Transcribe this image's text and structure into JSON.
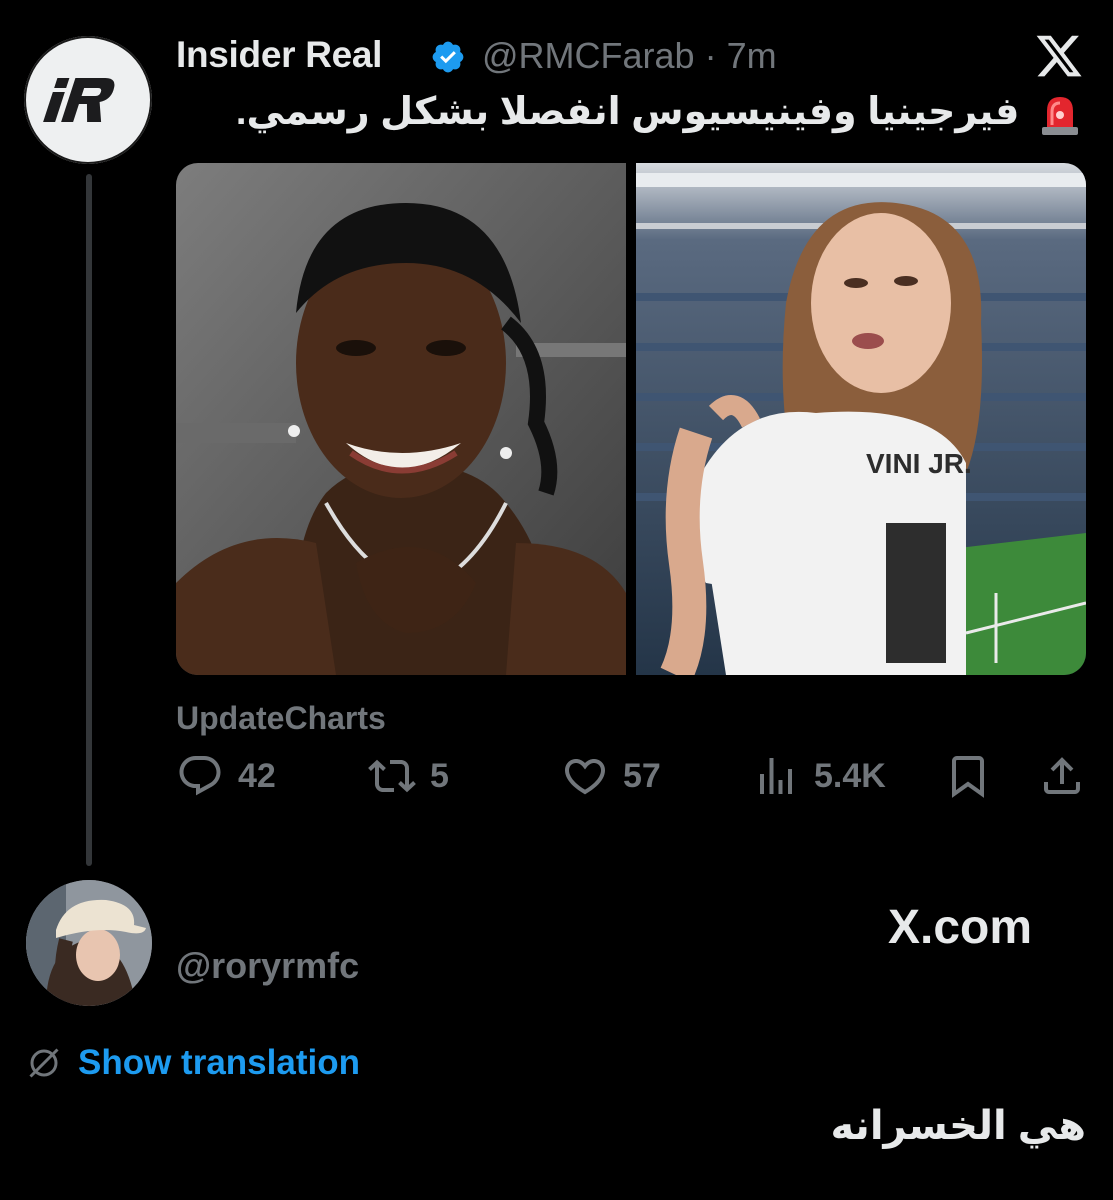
{
  "tweet": {
    "author_name": "Insider Real",
    "author_handle": "@RMCFarab",
    "separator": "·",
    "time": "7m",
    "text": "فيرجينيا وفينيسيوس انفصلا بشكل رسمي.",
    "avatar_logo_text": "iR",
    "source_label": "UpdateCharts",
    "jersey_text": "VINI JR.",
    "actions": {
      "replies": "42",
      "retweets": "5",
      "likes": "57",
      "views": "5.4K"
    }
  },
  "reply": {
    "handle": "@roryrmfc",
    "watermark": "X.com",
    "show_translation": "Show translation",
    "text": "هي الخسرانه"
  },
  "colors": {
    "background": "#000000",
    "text": "#e7e9ea",
    "muted": "#71767b",
    "link": "#1d9bf0",
    "verified": "#1d9bf0"
  }
}
